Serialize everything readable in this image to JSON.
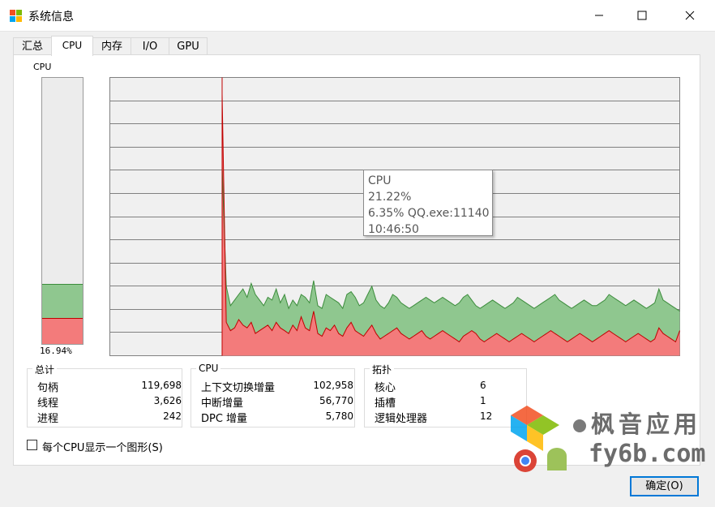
{
  "window": {
    "title": "系统信息"
  },
  "tabs": [
    {
      "label": "汇总",
      "active": false
    },
    {
      "label": "CPU",
      "active": true
    },
    {
      "label": "内存",
      "active": false
    },
    {
      "label": "I/O",
      "active": false
    },
    {
      "label": "GPU",
      "active": false
    }
  ],
  "cpu_meter": {
    "label": "CPU",
    "value_text": "16.94%",
    "total_percent": 16.94,
    "kernel_percent": 9.5
  },
  "colors": {
    "total_fill": "#8fc78f",
    "total_line": "#3c8c3c",
    "kernel_fill": "#f37b7b",
    "kernel_line": "#c00000",
    "grid": "#808080",
    "graph_bg": "#f0f0f0"
  },
  "chart_data": {
    "type": "area",
    "ylim": [
      0,
      100
    ],
    "grid": true,
    "start_fraction": 0.197,
    "series": [
      {
        "values": [
          68,
          25,
          18,
          20,
          22,
          24,
          21,
          26,
          22,
          20,
          18,
          21,
          20,
          24,
          19,
          22,
          17,
          20,
          18,
          22,
          21,
          19,
          27,
          18,
          17,
          22,
          21,
          20,
          19,
          17,
          22,
          23,
          21,
          18,
          19,
          22,
          25,
          20,
          18,
          17,
          19,
          22,
          21,
          19,
          18,
          17,
          18,
          19,
          20,
          21,
          20,
          19,
          20,
          21,
          20,
          19,
          18,
          19,
          21,
          22,
          20,
          18,
          17,
          18,
          19,
          20,
          19,
          18,
          17,
          18,
          19,
          21,
          20,
          19,
          18,
          17,
          18,
          19,
          20,
          21,
          22,
          20,
          19,
          18,
          17,
          18,
          19,
          20,
          19,
          18,
          18,
          19,
          20,
          22,
          21,
          20,
          19,
          18,
          19,
          20,
          19,
          18,
          17,
          18,
          19,
          24,
          20,
          19,
          18,
          17,
          16
        ]
      },
      {
        "values": [
          94,
          12,
          9,
          10,
          13,
          11,
          10,
          12,
          8,
          9,
          10,
          11,
          9,
          12,
          10,
          9,
          8,
          11,
          9,
          14,
          10,
          9,
          16,
          8,
          7,
          10,
          9,
          11,
          8,
          7,
          10,
          12,
          9,
          8,
          7,
          9,
          11,
          8,
          6,
          7,
          8,
          9,
          10,
          8,
          7,
          6,
          7,
          8,
          9,
          7,
          6,
          7,
          8,
          9,
          8,
          7,
          6,
          5,
          7,
          8,
          9,
          8,
          6,
          5,
          6,
          7,
          8,
          7,
          6,
          5,
          6,
          7,
          8,
          7,
          6,
          5,
          6,
          7,
          8,
          9,
          8,
          7,
          6,
          5,
          6,
          7,
          8,
          7,
          6,
          5,
          6,
          7,
          8,
          9,
          8,
          7,
          6,
          5,
          6,
          7,
          8,
          7,
          6,
          5,
          6,
          10,
          8,
          7,
          6,
          5,
          9
        ]
      }
    ]
  },
  "tooltip": {
    "line1": "CPU",
    "line2": "21.22%",
    "line3": "6.35% QQ.exe:11140",
    "line4": "10:46:50"
  },
  "totals": {
    "title": "总计",
    "rows": [
      {
        "label": "句柄",
        "value": "119,698"
      },
      {
        "label": "线程",
        "value": "3,626"
      },
      {
        "label": "进程",
        "value": "242"
      }
    ]
  },
  "cpu_group": {
    "title": "CPU",
    "rows": [
      {
        "label": "上下文切换增量",
        "value": "102,958"
      },
      {
        "label": "中断增量",
        "value": "56,770"
      },
      {
        "label": "DPC 增量",
        "value": "5,780"
      }
    ]
  },
  "topology": {
    "title": "拓扑",
    "rows": [
      {
        "label": "核心",
        "value": "6"
      },
      {
        "label": "插槽",
        "value": "1"
      },
      {
        "label": "逻辑处理器",
        "value": "12"
      }
    ]
  },
  "checkbox": {
    "label": "每个CPU显示一个图形(S)",
    "checked": false
  },
  "ok_button": {
    "label": "确定(O)"
  },
  "watermark": {
    "text1": "枫音应用",
    "text2": "fy6b.com"
  }
}
